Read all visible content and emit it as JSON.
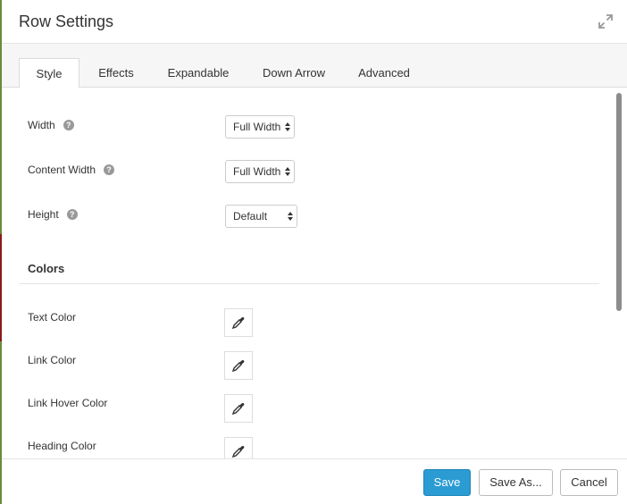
{
  "dialog": {
    "title": "Row Settings",
    "expand_icon": "expand-arrows-icon"
  },
  "tabs": [
    {
      "label": "Style",
      "active": true
    },
    {
      "label": "Effects",
      "active": false
    },
    {
      "label": "Expandable",
      "active": false
    },
    {
      "label": "Down Arrow",
      "active": false
    },
    {
      "label": "Advanced",
      "active": false
    }
  ],
  "fields": {
    "width": {
      "label": "Width",
      "value": "Full Width"
    },
    "content_width": {
      "label": "Content Width",
      "value": "Full Width"
    },
    "height": {
      "label": "Height",
      "value": "Default"
    }
  },
  "colors_section": {
    "title": "Colors",
    "items": [
      {
        "label": "Text Color",
        "icon": "eyedropper-icon"
      },
      {
        "label": "Link Color",
        "icon": "eyedropper-icon"
      },
      {
        "label": "Link Hover Color",
        "icon": "eyedropper-icon"
      },
      {
        "label": "Heading Color",
        "icon": "eyedropper-icon"
      }
    ]
  },
  "footer": {
    "save_label": "Save",
    "save_as_label": "Save As...",
    "cancel_label": "Cancel"
  },
  "theme": {
    "primary": "#2b9bd3"
  }
}
